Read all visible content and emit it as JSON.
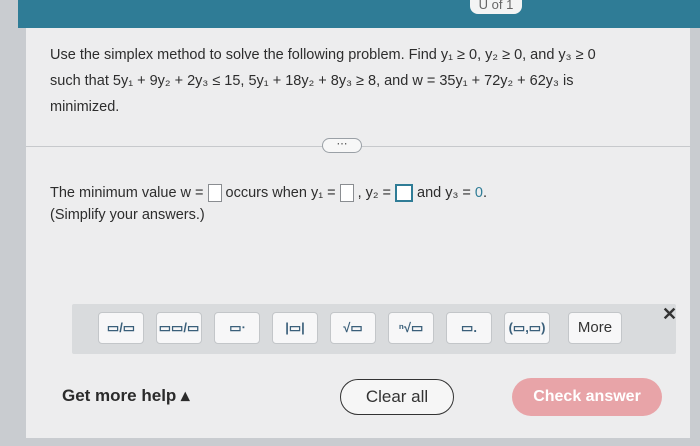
{
  "header": {
    "page_indicator": "U of 1"
  },
  "problem": {
    "intro": "Use the simplex method to solve the following problem. Find",
    "line2_prefix": "such that",
    "line2_mid": ", and",
    "line2_end": "is",
    "line3": "minimized.",
    "c1": "y₁ ≥ 0, y₂ ≥ 0, and y₃ ≥ 0",
    "c2": "5y₁ + 9y₂ + 2y₃ ≤ 15, 5y₁ + 18y₂ + 8y₃ ≥ 8",
    "objective": "w = 35y₁ + 72y₂ + 62y₃"
  },
  "ellipsis": "⋯",
  "answer": {
    "prefix": "The minimum value w =",
    "occurs": "occurs when y₁ =",
    "y2_label": ", y₂ =",
    "y3_label": "and y₃ =",
    "y3_value": "0",
    "period": ".",
    "hint": "(Simplify your answers.)"
  },
  "toolbar": {
    "tools": [
      "fraction",
      "mixed-number",
      "exponent",
      "absolute-value",
      "sqrt",
      "nth-root",
      "decimal",
      "ordered-pair"
    ],
    "tool_glyphs": [
      "▭/▭",
      "▭▭/▭",
      "▭ᐧ",
      "|▭|",
      "√▭",
      "ⁿ√▭",
      "▭.",
      "(▭,▭)"
    ],
    "more_label": "More",
    "close_glyph": "✕"
  },
  "footer": {
    "help_label": "Get more help ▴",
    "clear_label": "Clear all",
    "check_label": "Check answer"
  },
  "colors": {
    "accent": "#2f7c96",
    "check_button": "#e8a4a8"
  }
}
